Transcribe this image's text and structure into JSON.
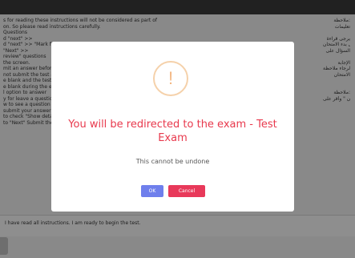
{
  "background": {
    "instructions_left": [
      "s for reading these instructions will not be considered as part of",
      "on. So please read instructions carefully.",
      "Questions",
      "d \"next\" >>",
      "d \"next\" >> \"Mark for review\"",
      "\"Next\" >>",
      "review\" questions",
      "the screen.",
      "mit an answer before submitting",
      "not submit the test at the",
      "e blank and the test will",
      "e blank during the exam",
      "l option to answer",
      "y for leave a question",
      "w to see a question",
      "submit your answer",
      "to check \"Show details\"",
      "to \"Next\" Submit the test"
    ],
    "instructions_right": [
      "ملاحظة:",
      "تعليمات",
      "",
      "يرجى قراءة",
      "قبل بدء الامتحان",
      "السؤال على",
      "",
      "الإجابة",
      "الرجاء ملاحظة",
      "الامتحان",
      "",
      "",
      "ملاحظة:",
      "الامتحان \" وأقر على"
    ],
    "agreement_text": "I have read all instructions. I am ready to begin the test."
  },
  "modal": {
    "icon": "exclamation-icon",
    "icon_glyph": "!",
    "title": "You will be redirected to the exam - Test Exam",
    "text": "This cannot be undone",
    "ok_label": "OK",
    "cancel_label": "Cancel"
  },
  "colors": {
    "title": "#e8394d",
    "ok_button": "#6f7fec",
    "cancel_button": "#e8395a",
    "warning_icon": "#f3b884"
  }
}
